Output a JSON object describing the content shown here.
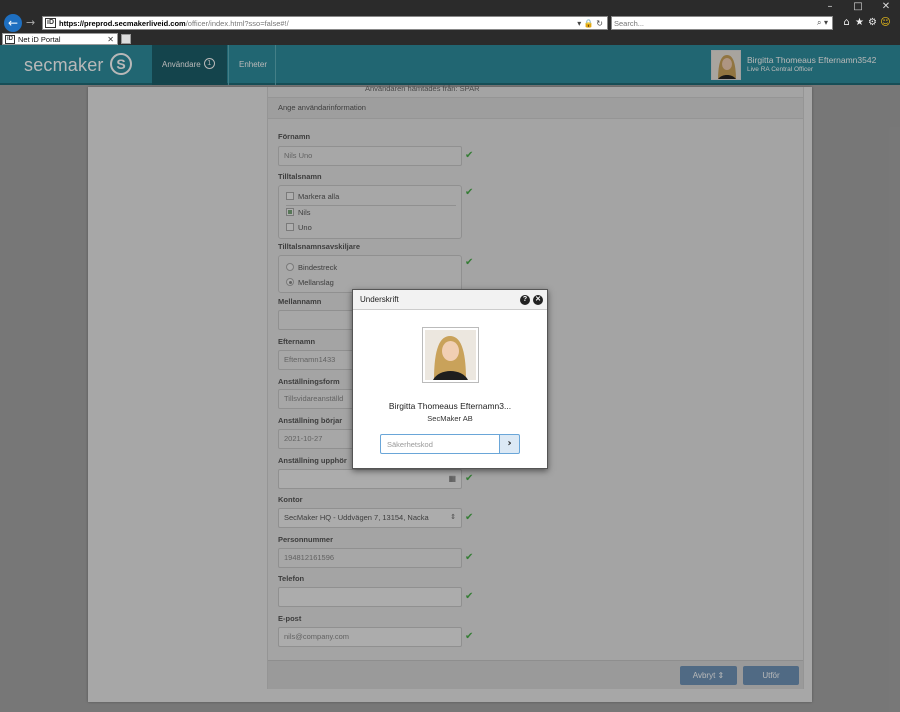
{
  "browser": {
    "url_host": "https://preprod.secmakerliveid.com",
    "url_path": "/officer/index.html?sso=false#!/",
    "search_placeholder": "Search...",
    "tab_title": "Net iD Portal",
    "favicon_text": "iD"
  },
  "header": {
    "logo_text": "secmaker",
    "nav": [
      {
        "label": "Användare",
        "badge": "1"
      },
      {
        "label": "Enheter"
      }
    ],
    "user_name": "Birgitta Thomeaus Efternamn3542",
    "user_role": "Live RA Central Officer"
  },
  "form": {
    "note": "Användaren hämtades från: SPAR",
    "section_title": "Ange användarinformation",
    "fornamn_label": "Förnamn",
    "fornamn_value": "Nils Uno",
    "tilltalsnamn_label": "Tilltalsnamn",
    "tilltalsnamn_options": [
      {
        "label": "Markera alla",
        "checked": false
      },
      {
        "label": "Nils",
        "checked": true
      },
      {
        "label": "Uno",
        "checked": false
      }
    ],
    "avskiljare_label": "Tilltalsnamnsavskiljare",
    "avskiljare_options": [
      {
        "label": "Bindestreck",
        "selected": false
      },
      {
        "label": "Mellanslag",
        "selected": true
      }
    ],
    "mellannamn_label": "Mellannamn",
    "mellannamn_value": "",
    "efternamn_label": "Efternamn",
    "efternamn_value": "Efternamn1433",
    "anstallningsform_label": "Anställningsform",
    "anstallningsform_value": "Tillsvidareanställd",
    "anstallning_borjar_label": "Anställning börjar",
    "anstallning_borjar_value": "2021-10-27",
    "anstallning_upphor_label": "Anställning upphör",
    "anstallning_upphor_value": "",
    "kontor_label": "Kontor",
    "kontor_value": "SecMaker HQ - Uddvägen 7, 13154, Nacka",
    "personnummer_label": "Personnummer",
    "personnummer_value": "194812161596",
    "telefon_label": "Telefon",
    "telefon_value": "",
    "epost_label": "E-post",
    "epost_value": "nils@company.com",
    "cancel_label": "Avbryt",
    "submit_label": "Utför"
  },
  "modal": {
    "title": "Underskrift",
    "name": "Birgitta Thomeaus Efternamn3...",
    "organization": "SecMaker AB",
    "code_placeholder": "Säkerhetskod"
  },
  "colors": {
    "header": "#2f8e9e",
    "header_active": "#1d5f6a",
    "valid_check": "#4cae4c",
    "button": "#6f94b8"
  }
}
